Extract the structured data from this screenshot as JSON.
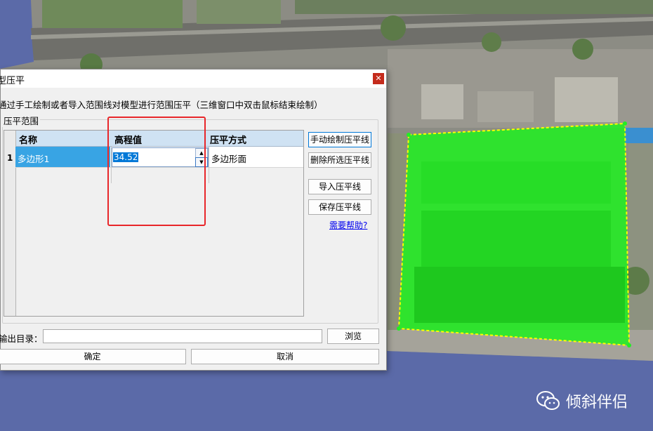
{
  "dialog": {
    "title": "型压平",
    "close_icon": "close-icon",
    "description": "通过手工绘制或者导入范围线对模型进行范围压平（三维窗口中双击鼠标结束绘制）",
    "group_label": "压平范围"
  },
  "grid": {
    "columns": [
      "名称",
      "高程值",
      "压平方式"
    ],
    "rows": [
      {
        "index": "1",
        "name": "多边形1",
        "elevation": "34.52",
        "mode": "多边形面"
      }
    ],
    "spin_up_icon": "spin-up-icon",
    "spin_down_icon": "spin-down-icon"
  },
  "side_buttons": {
    "draw": "手动绘制压平线",
    "delete": "删除所选压平线",
    "import": "导入压平线",
    "save": "保存压平线",
    "help": "需要帮助?"
  },
  "bottom": {
    "output_label": "输出目录：",
    "output_value": "",
    "browse": "浏览",
    "ok": "确定",
    "cancel": "取消"
  },
  "watermark": {
    "text": "倾斜伴侣",
    "icon": "wechat-icon"
  },
  "colors": {
    "selection": "#38a4e4",
    "header": "#cfe2f3",
    "highlight_box": "#e8262a",
    "polygon_fill": "#22ee22",
    "polygon_edge": "#ffff00"
  }
}
